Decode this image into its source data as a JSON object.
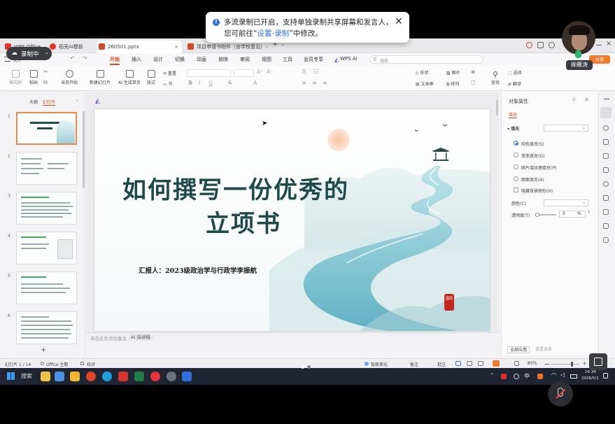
{
  "notification": {
    "line1": "多流录制已开启，支持单独录制共享屏幕和发言人，",
    "line2_prefix": "您可前往“",
    "line2_link": "设置-录制",
    "line2_suffix": "”中修改。"
  },
  "recording": {
    "label": "录制中"
  },
  "speaker": {
    "name": "柳雁涛"
  },
  "tabs": [
    {
      "label": "WPS Office",
      "color": "#e0352b"
    },
    {
      "label": "稻壳AI模板",
      "color": "#e0352b"
    },
    {
      "label": "260501.pptx",
      "color": "#d24726"
    },
    {
      "label": "项目申请书附件（含学校意见）-...",
      "color": "#d24726"
    }
  ],
  "ribbon_tabs": [
    "开始",
    "插入",
    "设计",
    "切换",
    "动画",
    "放映",
    "审阅",
    "视图",
    "工具",
    "会员专享",
    "WPS AI"
  ],
  "search_placeholder": "搜索",
  "share_label": "分享",
  "ribbon": {
    "format_painter": "格式刷",
    "paste": "粘贴",
    "play": "当页开始",
    "new_slide": "新建幻灯片",
    "ai_slide": "AI 生成单页",
    "layout": "版式",
    "reset": "重置",
    "section": "节",
    "shapes": "形状",
    "image": "图片",
    "textbox": "文本框",
    "arrange": "排列",
    "find": "查找",
    "select": "选择",
    "translate": "翻译"
  },
  "left_panel": {
    "tab_outline": "大纲",
    "tab_slides": "幻灯片",
    "slide_numbers": [
      "1",
      "2",
      "3",
      "4",
      "5",
      "6"
    ],
    "add": "+"
  },
  "slide": {
    "title_line1": "如何撰写一份优秀的",
    "title_line2": "立项书",
    "presenter": "汇报人：2023级政治学与行政学李振航",
    "seal": "国风"
  },
  "notes_placeholder": "单击此处添加备注",
  "ai_script": "AI 演讲稿",
  "right_panel": {
    "title": "对象属性",
    "tab_fill": "填充",
    "section_fill": "填充",
    "options": [
      "纯色填充(S)",
      "渐变填充(G)",
      "图片或纹理填充(P)",
      "图案填充(A)"
    ],
    "hide_bg": "隐藏背景图形(H)",
    "color_label": "颜色(C)",
    "transparency_label": "透明度(T)",
    "transparency_value": "0",
    "transparency_unit": "%",
    "apply_all": "全部应用",
    "reset_bg": "重置背景"
  },
  "status": {
    "slide_count": "幻灯片 1 / 14",
    "theme": "Office 主题",
    "proof": "校对",
    "smart": "智能美化",
    "notes": "备注",
    "comments": "批注",
    "zoom": "85%"
  },
  "taskbar": {
    "search": "搜索",
    "input_mode": "中",
    "time": "16:34",
    "date": "2026/5/1"
  },
  "colors": {
    "accent": "#d84b16",
    "link": "#2f6fdb",
    "selection": "#e98a4e"
  }
}
